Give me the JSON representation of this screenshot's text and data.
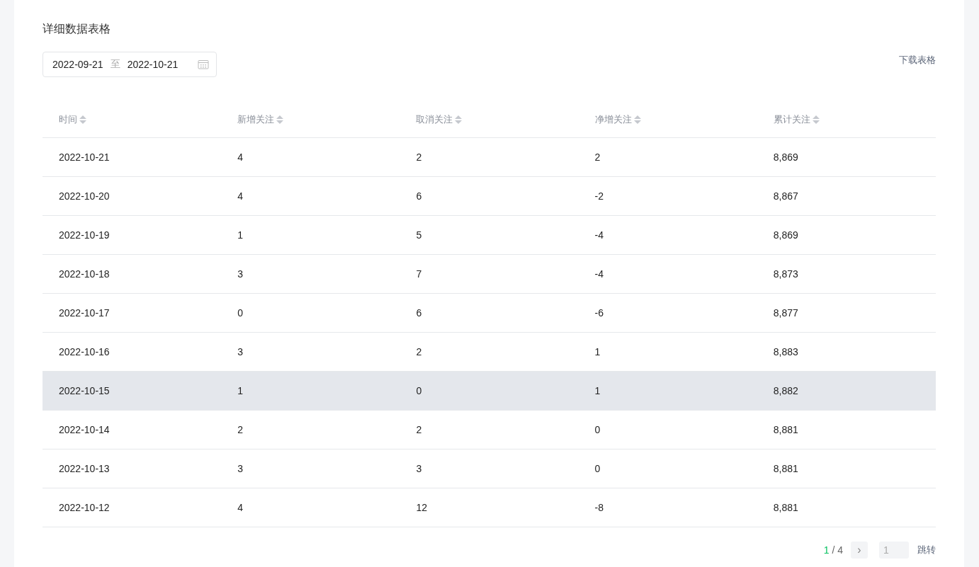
{
  "title": "详细数据表格",
  "date_range": {
    "start": "2022-09-21",
    "separator": "至",
    "end": "2022-10-21"
  },
  "download_link": "下载表格",
  "table": {
    "columns": [
      "时间",
      "新增关注",
      "取消关注",
      "净增关注",
      "累计关注"
    ],
    "rows": [
      {
        "cells": [
          "2022-10-21",
          "4",
          "2",
          "2",
          "8,869"
        ],
        "highlighted": false
      },
      {
        "cells": [
          "2022-10-20",
          "4",
          "6",
          "-2",
          "8,867"
        ],
        "highlighted": false
      },
      {
        "cells": [
          "2022-10-19",
          "1",
          "5",
          "-4",
          "8,869"
        ],
        "highlighted": false
      },
      {
        "cells": [
          "2022-10-18",
          "3",
          "7",
          "-4",
          "8,873"
        ],
        "highlighted": false
      },
      {
        "cells": [
          "2022-10-17",
          "0",
          "6",
          "-6",
          "8,877"
        ],
        "highlighted": false
      },
      {
        "cells": [
          "2022-10-16",
          "3",
          "2",
          "1",
          "8,883"
        ],
        "highlighted": false
      },
      {
        "cells": [
          "2022-10-15",
          "1",
          "0",
          "1",
          "8,882"
        ],
        "highlighted": true
      },
      {
        "cells": [
          "2022-10-14",
          "2",
          "2",
          "0",
          "8,881"
        ],
        "highlighted": false
      },
      {
        "cells": [
          "2022-10-13",
          "3",
          "3",
          "0",
          "8,881"
        ],
        "highlighted": false
      },
      {
        "cells": [
          "2022-10-12",
          "4",
          "12",
          "-8",
          "8,881"
        ],
        "highlighted": false
      }
    ]
  },
  "pagination": {
    "current": "1",
    "total": "/ 4",
    "next": "›",
    "jump_placeholder": "1",
    "jump_button": "跳转"
  }
}
